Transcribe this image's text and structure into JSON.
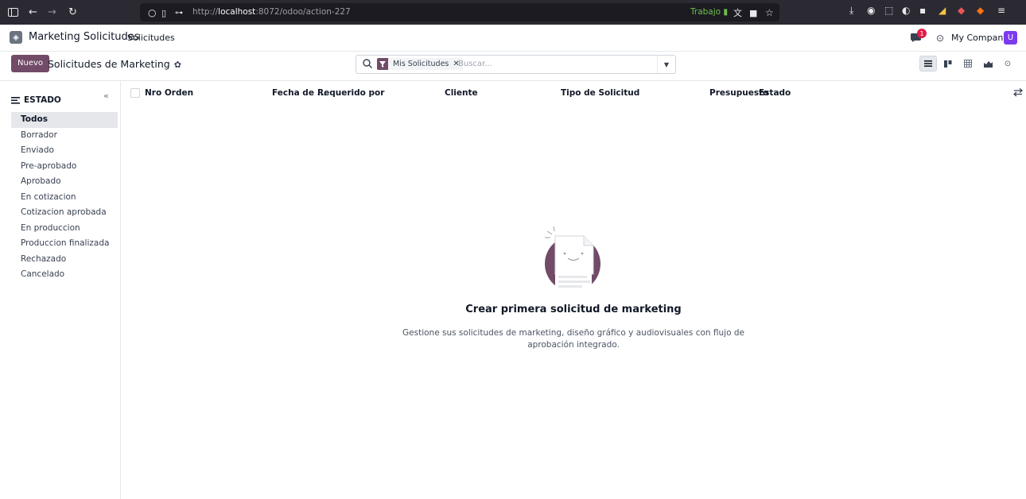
{
  "browser": {
    "url_prefix": "http://",
    "url_host": "localhost",
    "url_path": ":8072/odoo/action-227",
    "container_label": "Trabajo"
  },
  "navbar": {
    "app_name": "Marketing Solicitudes",
    "menu_item": "Solicitudes",
    "chat_badge": "1",
    "company": "My Company",
    "avatar_letter": "U"
  },
  "control": {
    "new_label": "Nuevo",
    "title": "Solicitudes de Marketing",
    "facet_label": "Mis Solicitudes",
    "search_placeholder": "Buscar..."
  },
  "sidebar": {
    "header": "ESTADO",
    "items": [
      {
        "label": "Todos",
        "active": true
      },
      {
        "label": "Borrador"
      },
      {
        "label": "Enviado"
      },
      {
        "label": "Pre-aprobado"
      },
      {
        "label": "Aprobado"
      },
      {
        "label": "En cotizacion"
      },
      {
        "label": "Cotizacion aprobada"
      },
      {
        "label": "En produccion"
      },
      {
        "label": "Produccion finalizada"
      },
      {
        "label": "Rechazado"
      },
      {
        "label": "Cancelado"
      }
    ]
  },
  "list": {
    "columns": [
      "Nro Orden",
      "Fecha de ...",
      "Requerido por",
      "Cliente",
      "Tipo de Solicitud",
      "Presupuesto",
      "Estado"
    ]
  },
  "empty_state": {
    "title": "Crear primera solicitud de marketing",
    "line1": "Gestione sus solicitudes de marketing, diseño gráfico y audiovisuales con flujo de",
    "line2": "aprobación integrado."
  },
  "colors": {
    "primary": "#714b67",
    "browser_bg": "#2b2a33"
  }
}
